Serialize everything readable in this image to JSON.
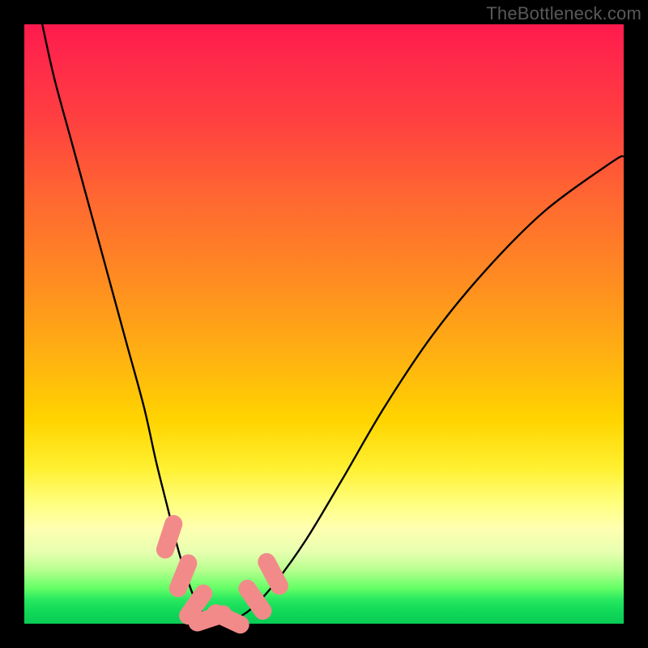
{
  "watermark": "TheBottleneck.com",
  "chart_data": {
    "type": "line",
    "title": "",
    "xlabel": "",
    "ylabel": "",
    "xlim": [
      0,
      100
    ],
    "ylim": [
      0,
      100
    ],
    "grid": false,
    "legend": false,
    "series": [
      {
        "name": "bottleneck-curve",
        "color": "#000000",
        "x": [
          3,
          5,
          8,
          11,
          14,
          17,
          20,
          22,
          24,
          25.5,
          27,
          28.5,
          30,
          31.5,
          33,
          35,
          38,
          42,
          47,
          53,
          60,
          68,
          77,
          87,
          98,
          100
        ],
        "y": [
          100,
          91,
          80,
          69,
          58,
          47,
          36,
          27,
          19,
          13,
          8,
          4,
          1.5,
          0.4,
          0.2,
          0.7,
          2.6,
          7,
          14,
          24,
          36,
          48,
          59,
          69,
          77,
          78
        ]
      }
    ],
    "markers": [
      {
        "shape": "pill",
        "x": 24.2,
        "y": 14.5,
        "angle": -72,
        "len": 4.5
      },
      {
        "shape": "pill",
        "x": 26.5,
        "y": 8.0,
        "angle": -68,
        "len": 4.5
      },
      {
        "shape": "pill",
        "x": 28.6,
        "y": 3.2,
        "angle": -55,
        "len": 4.5
      },
      {
        "shape": "pill",
        "x": 31.0,
        "y": 0.9,
        "angle": -18,
        "len": 4.5
      },
      {
        "shape": "pill",
        "x": 34.0,
        "y": 0.8,
        "angle": 25,
        "len": 4.5
      },
      {
        "shape": "pill",
        "x": 38.5,
        "y": 4.0,
        "angle": 55,
        "len": 4.5
      },
      {
        "shape": "pill",
        "x": 41.5,
        "y": 8.3,
        "angle": 62,
        "len": 4.5
      }
    ],
    "marker_color": "#f28a8a"
  }
}
